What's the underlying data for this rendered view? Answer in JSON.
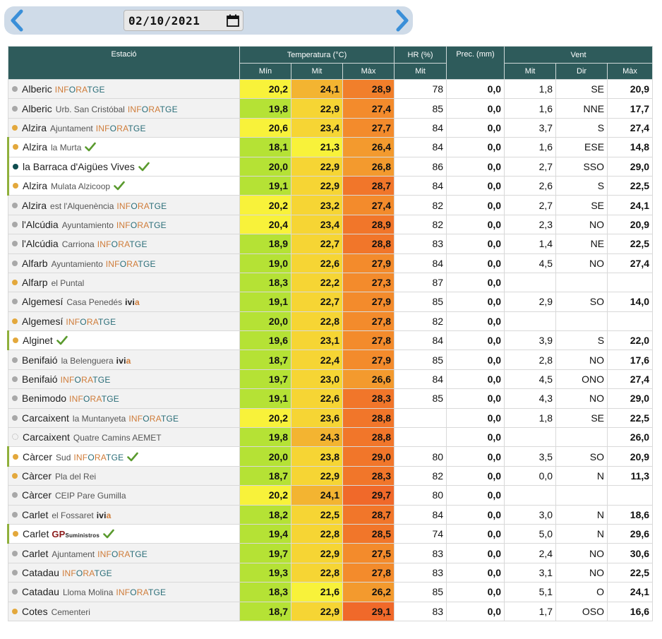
{
  "nav": {
    "date": "02/10/2021",
    "prev_icon": "chevron-left-icon",
    "next_icon": "chevron-right-icon",
    "calendar_icon": "calendar-icon"
  },
  "headers": {
    "station": "Estació",
    "temperature": "Temperatura (°C)",
    "humidity": "HR (%)",
    "precipitation": "Prec. (mm)",
    "wind": "Vent",
    "t_min": "Mín",
    "t_mit": "Mit",
    "t_max": "Màx",
    "hr_mit": "Mit",
    "w_mit": "Mit",
    "w_dir": "Dir",
    "w_max": "Màx"
  },
  "colors": {
    "header_bg": "#2e5b5b",
    "dot_grey": "#a8a8a8",
    "dot_orange": "#e3a83c",
    "dot_teal": "#0f4d4f",
    "check_green": "#5a9a2e"
  },
  "rows": [
    {
      "name": "Alberic",
      "sub": "",
      "brand": "INFORATGE",
      "dot": "grey",
      "hl": false,
      "check": false,
      "tmin": "20,2",
      "tmit": "24,1",
      "tmax": "28,9",
      "hr": "78",
      "prec": "0,0",
      "wmit": "1,8",
      "wdir": "SE",
      "wmax": "20,9",
      "cmin": "#f8f23a",
      "cmit": "#f3b431",
      "cmax": "#f17f2b"
    },
    {
      "name": "Alberic",
      "sub": "Urb. San Cristóbal",
      "brand": "INFORATGE",
      "dot": "grey",
      "hl": false,
      "check": false,
      "tmin": "19,8",
      "tmit": "22,9",
      "tmax": "27,4",
      "hr": "85",
      "prec": "0,0",
      "wmit": "1,6",
      "wdir": "NNE",
      "wmax": "17,7",
      "cmin": "#b5e235",
      "cmit": "#f6d534",
      "cmax": "#f38b2c"
    },
    {
      "name": "Alzira",
      "sub": "Ajuntament",
      "brand": "INFORATGE",
      "dot": "orange",
      "hl": false,
      "check": false,
      "tmin": "20,6",
      "tmit": "23,4",
      "tmax": "27,7",
      "hr": "84",
      "prec": "0,0",
      "wmit": "3,7",
      "wdir": "S",
      "wmax": "27,4",
      "cmin": "#f8f23a",
      "cmit": "#f6d534",
      "cmax": "#f38b2c"
    },
    {
      "name": "Alzira",
      "sub": "la Murta",
      "brand": "",
      "dot": "orange",
      "hl": true,
      "check": true,
      "tmin": "18,1",
      "tmit": "21,3",
      "tmax": "26,4",
      "hr": "84",
      "prec": "0,0",
      "wmit": "1,6",
      "wdir": "ESE",
      "wmax": "14,8",
      "cmin": "#b5e235",
      "cmit": "#f8f23a",
      "cmax": "#f39a2e"
    },
    {
      "name": "la Barraca d'Aigües Vives",
      "sub": "",
      "brand": "",
      "dot": "teal",
      "hl": true,
      "check": true,
      "tmin": "20,0",
      "tmit": "22,9",
      "tmax": "26,8",
      "hr": "86",
      "prec": "0,0",
      "wmit": "2,7",
      "wdir": "SSO",
      "wmax": "29,0",
      "cmin": "#b5e235",
      "cmit": "#f6d534",
      "cmax": "#f39a2e"
    },
    {
      "name": "Alzira",
      "sub": "Mulata Alzicoop",
      "brand": "",
      "dot": "orange",
      "hl": true,
      "check": true,
      "tmin": "19,1",
      "tmit": "22,9",
      "tmax": "28,7",
      "hr": "84",
      "prec": "0,0",
      "wmit": "2,6",
      "wdir": "S",
      "wmax": "22,5",
      "cmin": "#b5e235",
      "cmit": "#f6d534",
      "cmax": "#f1762a"
    },
    {
      "name": "Alzira",
      "sub": "est l'Alquenència",
      "brand": "INFORATGE",
      "dot": "grey",
      "hl": false,
      "check": false,
      "tmin": "20,2",
      "tmit": "23,2",
      "tmax": "27,4",
      "hr": "82",
      "prec": "0,0",
      "wmit": "2,7",
      "wdir": "SE",
      "wmax": "24,1",
      "cmin": "#f8f23a",
      "cmit": "#f6d534",
      "cmax": "#f38b2c"
    },
    {
      "name": "l'Alcúdia",
      "sub": "Ayuntamiento",
      "brand": "INFORATGE",
      "dot": "grey",
      "hl": false,
      "check": false,
      "tmin": "20,4",
      "tmit": "23,4",
      "tmax": "28,9",
      "hr": "82",
      "prec": "0,0",
      "wmit": "2,3",
      "wdir": "NO",
      "wmax": "20,9",
      "cmin": "#f8f23a",
      "cmit": "#f6d534",
      "cmax": "#f1762a"
    },
    {
      "name": "l'Alcúdia",
      "sub": "Carriona",
      "brand": "INFORATGE",
      "dot": "grey",
      "hl": false,
      "check": false,
      "tmin": "18,9",
      "tmit": "22,7",
      "tmax": "28,8",
      "hr": "83",
      "prec": "0,0",
      "wmit": "1,4",
      "wdir": "NE",
      "wmax": "22,5",
      "cmin": "#b5e235",
      "cmit": "#f6d534",
      "cmax": "#f1762a"
    },
    {
      "name": "Alfarb",
      "sub": "Ayuntamiento",
      "brand": "INFORATGE",
      "dot": "grey",
      "hl": false,
      "check": false,
      "tmin": "19,0",
      "tmit": "22,6",
      "tmax": "27,9",
      "hr": "84",
      "prec": "0,0",
      "wmit": "4,5",
      "wdir": "NO",
      "wmax": "27,4",
      "cmin": "#b5e235",
      "cmit": "#f6d534",
      "cmax": "#f38b2c"
    },
    {
      "name": "Alfarp",
      "sub": "el Puntal",
      "brand": "",
      "dot": "orange",
      "hl": false,
      "check": false,
      "tmin": "18,3",
      "tmit": "22,2",
      "tmax": "27,3",
      "hr": "87",
      "prec": "0,0",
      "wmit": "",
      "wdir": "",
      "wmax": "",
      "cmin": "#b5e235",
      "cmit": "#f6d534",
      "cmax": "#f38b2c"
    },
    {
      "name": "Algemesí",
      "sub": "Casa Penedés",
      "brand": "ivia",
      "dot": "grey",
      "hl": false,
      "check": false,
      "tmin": "19,1",
      "tmit": "22,7",
      "tmax": "27,9",
      "hr": "85",
      "prec": "0,0",
      "wmit": "2,9",
      "wdir": "SO",
      "wmax": "14,0",
      "cmin": "#b5e235",
      "cmit": "#f6d534",
      "cmax": "#f38b2c"
    },
    {
      "name": "Algemesí",
      "sub": "",
      "brand": "INFORATGE",
      "dot": "orange",
      "hl": false,
      "check": false,
      "tmin": "20,0",
      "tmit": "22,8",
      "tmax": "27,8",
      "hr": "82",
      "prec": "0,0",
      "wmit": "",
      "wdir": "",
      "wmax": "",
      "cmin": "#b5e235",
      "cmit": "#f6d534",
      "cmax": "#f38b2c"
    },
    {
      "name": "Alginet",
      "sub": "",
      "brand": "",
      "dot": "orange",
      "hl": true,
      "check": true,
      "tmin": "19,6",
      "tmit": "23,1",
      "tmax": "27,8",
      "hr": "84",
      "prec": "0,0",
      "wmit": "3,9",
      "wdir": "S",
      "wmax": "22,0",
      "cmin": "#b5e235",
      "cmit": "#f6d534",
      "cmax": "#f38b2c"
    },
    {
      "name": "Benifaió",
      "sub": "la Belenguera",
      "brand": "ivia",
      "dot": "grey",
      "hl": false,
      "check": false,
      "tmin": "18,7",
      "tmit": "22,4",
      "tmax": "27,9",
      "hr": "85",
      "prec": "0,0",
      "wmit": "2,8",
      "wdir": "NO",
      "wmax": "17,6",
      "cmin": "#b5e235",
      "cmit": "#f6d534",
      "cmax": "#f38b2c"
    },
    {
      "name": "Benifaió",
      "sub": "",
      "brand": "INFORATGE",
      "dot": "grey",
      "hl": false,
      "check": false,
      "tmin": "19,7",
      "tmit": "23,0",
      "tmax": "26,6",
      "hr": "84",
      "prec": "0,0",
      "wmit": "4,5",
      "wdir": "ONO",
      "wmax": "27,4",
      "cmin": "#b5e235",
      "cmit": "#f6d534",
      "cmax": "#f39a2e"
    },
    {
      "name": "Benimodo",
      "sub": "",
      "brand": "INFORATGE",
      "dot": "grey",
      "hl": false,
      "check": false,
      "tmin": "19,1",
      "tmit": "22,6",
      "tmax": "28,3",
      "hr": "85",
      "prec": "0,0",
      "wmit": "4,3",
      "wdir": "NO",
      "wmax": "29,0",
      "cmin": "#b5e235",
      "cmit": "#f6d534",
      "cmax": "#f1762a"
    },
    {
      "name": "Carcaixent",
      "sub": "la Muntanyeta",
      "brand": "INFORATGE",
      "dot": "grey",
      "hl": false,
      "check": false,
      "tmin": "20,2",
      "tmit": "23,6",
      "tmax": "28,8",
      "hr": "",
      "prec": "0,0",
      "wmit": "1,8",
      "wdir": "SE",
      "wmax": "22,5",
      "cmin": "#f8f23a",
      "cmit": "#f6d534",
      "cmax": "#f1762a"
    },
    {
      "name": "Carcaixent",
      "sub": "Quatre Camins AEMET",
      "brand": "",
      "dot": "empty",
      "hl": false,
      "check": false,
      "tmin": "19,8",
      "tmit": "24,3",
      "tmax": "28,8",
      "hr": "",
      "prec": "0,0",
      "wmit": "",
      "wdir": "",
      "wmax": "26,0",
      "cmin": "#b5e235",
      "cmit": "#f3b431",
      "cmax": "#f1762a"
    },
    {
      "name": "Càrcer",
      "sub": "Sud",
      "brand": "INFORATGE",
      "dot": "orange",
      "hl": true,
      "check": true,
      "tmin": "20,0",
      "tmit": "23,8",
      "tmax": "29,0",
      "hr": "80",
      "prec": "0,0",
      "wmit": "3,5",
      "wdir": "SO",
      "wmax": "20,9",
      "cmin": "#b5e235",
      "cmit": "#f6d534",
      "cmax": "#f1762a"
    },
    {
      "name": "Càrcer",
      "sub": "Pla del Rei",
      "brand": "",
      "dot": "orange",
      "hl": false,
      "check": false,
      "tmin": "18,7",
      "tmit": "22,9",
      "tmax": "28,3",
      "hr": "82",
      "prec": "0,0",
      "wmit": "0,0",
      "wdir": "N",
      "wmax": "11,3",
      "cmin": "#b5e235",
      "cmit": "#f6d534",
      "cmax": "#f1762a"
    },
    {
      "name": "Càrcer",
      "sub": "CEIP Pare Gumilla",
      "brand": "",
      "dot": "grey",
      "hl": false,
      "check": false,
      "tmin": "20,2",
      "tmit": "24,1",
      "tmax": "29,7",
      "hr": "80",
      "prec": "0,0",
      "wmit": "",
      "wdir": "",
      "wmax": "",
      "cmin": "#f8f23a",
      "cmit": "#f3b431",
      "cmax": "#f0692a"
    },
    {
      "name": "Carlet",
      "sub": "el Fossaret",
      "brand": "ivia",
      "dot": "grey",
      "hl": false,
      "check": false,
      "tmin": "18,2",
      "tmit": "22,5",
      "tmax": "28,7",
      "hr": "84",
      "prec": "0,0",
      "wmit": "3,0",
      "wdir": "N",
      "wmax": "18,6",
      "cmin": "#b5e235",
      "cmit": "#f6d534",
      "cmax": "#f1762a"
    },
    {
      "name": "Carlet",
      "sub": "",
      "brand": "GP",
      "dot": "orange",
      "hl": true,
      "check": true,
      "tmin": "19,4",
      "tmit": "22,8",
      "tmax": "28,5",
      "hr": "74",
      "prec": "0,0",
      "wmit": "5,0",
      "wdir": "N",
      "wmax": "29,6",
      "cmin": "#b5e235",
      "cmit": "#f6d534",
      "cmax": "#f1762a"
    },
    {
      "name": "Carlet",
      "sub": "Ajuntament",
      "brand": "INFORATGE",
      "dot": "grey",
      "hl": false,
      "check": false,
      "tmin": "19,7",
      "tmit": "22,9",
      "tmax": "27,5",
      "hr": "83",
      "prec": "0,0",
      "wmit": "2,4",
      "wdir": "NO",
      "wmax": "30,6",
      "cmin": "#b5e235",
      "cmit": "#f6d534",
      "cmax": "#f38b2c"
    },
    {
      "name": "Catadau",
      "sub": "",
      "brand": "INFORATGE",
      "dot": "grey",
      "hl": false,
      "check": false,
      "tmin": "19,3",
      "tmit": "22,8",
      "tmax": "27,8",
      "hr": "83",
      "prec": "0,0",
      "wmit": "3,1",
      "wdir": "NO",
      "wmax": "22,5",
      "cmin": "#b5e235",
      "cmit": "#f6d534",
      "cmax": "#f38b2c"
    },
    {
      "name": "Catadau",
      "sub": "Lloma Molina",
      "brand": "INFORATGE",
      "dot": "grey",
      "hl": false,
      "check": false,
      "tmin": "18,3",
      "tmit": "21,6",
      "tmax": "26,2",
      "hr": "85",
      "prec": "0,0",
      "wmit": "5,1",
      "wdir": "O",
      "wmax": "24,1",
      "cmin": "#b5e235",
      "cmit": "#f8f23a",
      "cmax": "#f39a2e"
    },
    {
      "name": "Cotes",
      "sub": "Cementeri",
      "brand": "",
      "dot": "orange",
      "hl": false,
      "check": false,
      "tmin": "18,7",
      "tmit": "22,9",
      "tmax": "29,1",
      "hr": "83",
      "prec": "0,0",
      "wmit": "1,7",
      "wdir": "OSO",
      "wmax": "16,6",
      "cmin": "#b5e235",
      "cmit": "#f6d534",
      "cmax": "#f0692a"
    }
  ]
}
